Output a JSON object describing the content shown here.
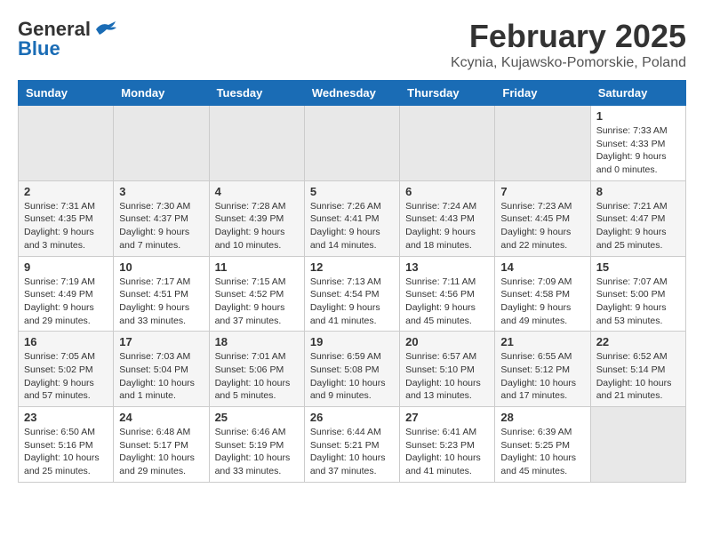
{
  "header": {
    "logo_general": "General",
    "logo_blue": "Blue",
    "title": "February 2025",
    "subtitle": "Kcynia, Kujawsko-Pomorskie, Poland"
  },
  "calendar": {
    "days_of_week": [
      "Sunday",
      "Monday",
      "Tuesday",
      "Wednesday",
      "Thursday",
      "Friday",
      "Saturday"
    ],
    "weeks": [
      [
        {
          "day": "",
          "info": ""
        },
        {
          "day": "",
          "info": ""
        },
        {
          "day": "",
          "info": ""
        },
        {
          "day": "",
          "info": ""
        },
        {
          "day": "",
          "info": ""
        },
        {
          "day": "",
          "info": ""
        },
        {
          "day": "1",
          "info": "Sunrise: 7:33 AM\nSunset: 4:33 PM\nDaylight: 9 hours and 0 minutes."
        }
      ],
      [
        {
          "day": "2",
          "info": "Sunrise: 7:31 AM\nSunset: 4:35 PM\nDaylight: 9 hours and 3 minutes."
        },
        {
          "day": "3",
          "info": "Sunrise: 7:30 AM\nSunset: 4:37 PM\nDaylight: 9 hours and 7 minutes."
        },
        {
          "day": "4",
          "info": "Sunrise: 7:28 AM\nSunset: 4:39 PM\nDaylight: 9 hours and 10 minutes."
        },
        {
          "day": "5",
          "info": "Sunrise: 7:26 AM\nSunset: 4:41 PM\nDaylight: 9 hours and 14 minutes."
        },
        {
          "day": "6",
          "info": "Sunrise: 7:24 AM\nSunset: 4:43 PM\nDaylight: 9 hours and 18 minutes."
        },
        {
          "day": "7",
          "info": "Sunrise: 7:23 AM\nSunset: 4:45 PM\nDaylight: 9 hours and 22 minutes."
        },
        {
          "day": "8",
          "info": "Sunrise: 7:21 AM\nSunset: 4:47 PM\nDaylight: 9 hours and 25 minutes."
        }
      ],
      [
        {
          "day": "9",
          "info": "Sunrise: 7:19 AM\nSunset: 4:49 PM\nDaylight: 9 hours and 29 minutes."
        },
        {
          "day": "10",
          "info": "Sunrise: 7:17 AM\nSunset: 4:51 PM\nDaylight: 9 hours and 33 minutes."
        },
        {
          "day": "11",
          "info": "Sunrise: 7:15 AM\nSunset: 4:52 PM\nDaylight: 9 hours and 37 minutes."
        },
        {
          "day": "12",
          "info": "Sunrise: 7:13 AM\nSunset: 4:54 PM\nDaylight: 9 hours and 41 minutes."
        },
        {
          "day": "13",
          "info": "Sunrise: 7:11 AM\nSunset: 4:56 PM\nDaylight: 9 hours and 45 minutes."
        },
        {
          "day": "14",
          "info": "Sunrise: 7:09 AM\nSunset: 4:58 PM\nDaylight: 9 hours and 49 minutes."
        },
        {
          "day": "15",
          "info": "Sunrise: 7:07 AM\nSunset: 5:00 PM\nDaylight: 9 hours and 53 minutes."
        }
      ],
      [
        {
          "day": "16",
          "info": "Sunrise: 7:05 AM\nSunset: 5:02 PM\nDaylight: 9 hours and 57 minutes."
        },
        {
          "day": "17",
          "info": "Sunrise: 7:03 AM\nSunset: 5:04 PM\nDaylight: 10 hours and 1 minute."
        },
        {
          "day": "18",
          "info": "Sunrise: 7:01 AM\nSunset: 5:06 PM\nDaylight: 10 hours and 5 minutes."
        },
        {
          "day": "19",
          "info": "Sunrise: 6:59 AM\nSunset: 5:08 PM\nDaylight: 10 hours and 9 minutes."
        },
        {
          "day": "20",
          "info": "Sunrise: 6:57 AM\nSunset: 5:10 PM\nDaylight: 10 hours and 13 minutes."
        },
        {
          "day": "21",
          "info": "Sunrise: 6:55 AM\nSunset: 5:12 PM\nDaylight: 10 hours and 17 minutes."
        },
        {
          "day": "22",
          "info": "Sunrise: 6:52 AM\nSunset: 5:14 PM\nDaylight: 10 hours and 21 minutes."
        }
      ],
      [
        {
          "day": "23",
          "info": "Sunrise: 6:50 AM\nSunset: 5:16 PM\nDaylight: 10 hours and 25 minutes."
        },
        {
          "day": "24",
          "info": "Sunrise: 6:48 AM\nSunset: 5:17 PM\nDaylight: 10 hours and 29 minutes."
        },
        {
          "day": "25",
          "info": "Sunrise: 6:46 AM\nSunset: 5:19 PM\nDaylight: 10 hours and 33 minutes."
        },
        {
          "day": "26",
          "info": "Sunrise: 6:44 AM\nSunset: 5:21 PM\nDaylight: 10 hours and 37 minutes."
        },
        {
          "day": "27",
          "info": "Sunrise: 6:41 AM\nSunset: 5:23 PM\nDaylight: 10 hours and 41 minutes."
        },
        {
          "day": "28",
          "info": "Sunrise: 6:39 AM\nSunset: 5:25 PM\nDaylight: 10 hours and 45 minutes."
        },
        {
          "day": "",
          "info": ""
        }
      ]
    ]
  }
}
